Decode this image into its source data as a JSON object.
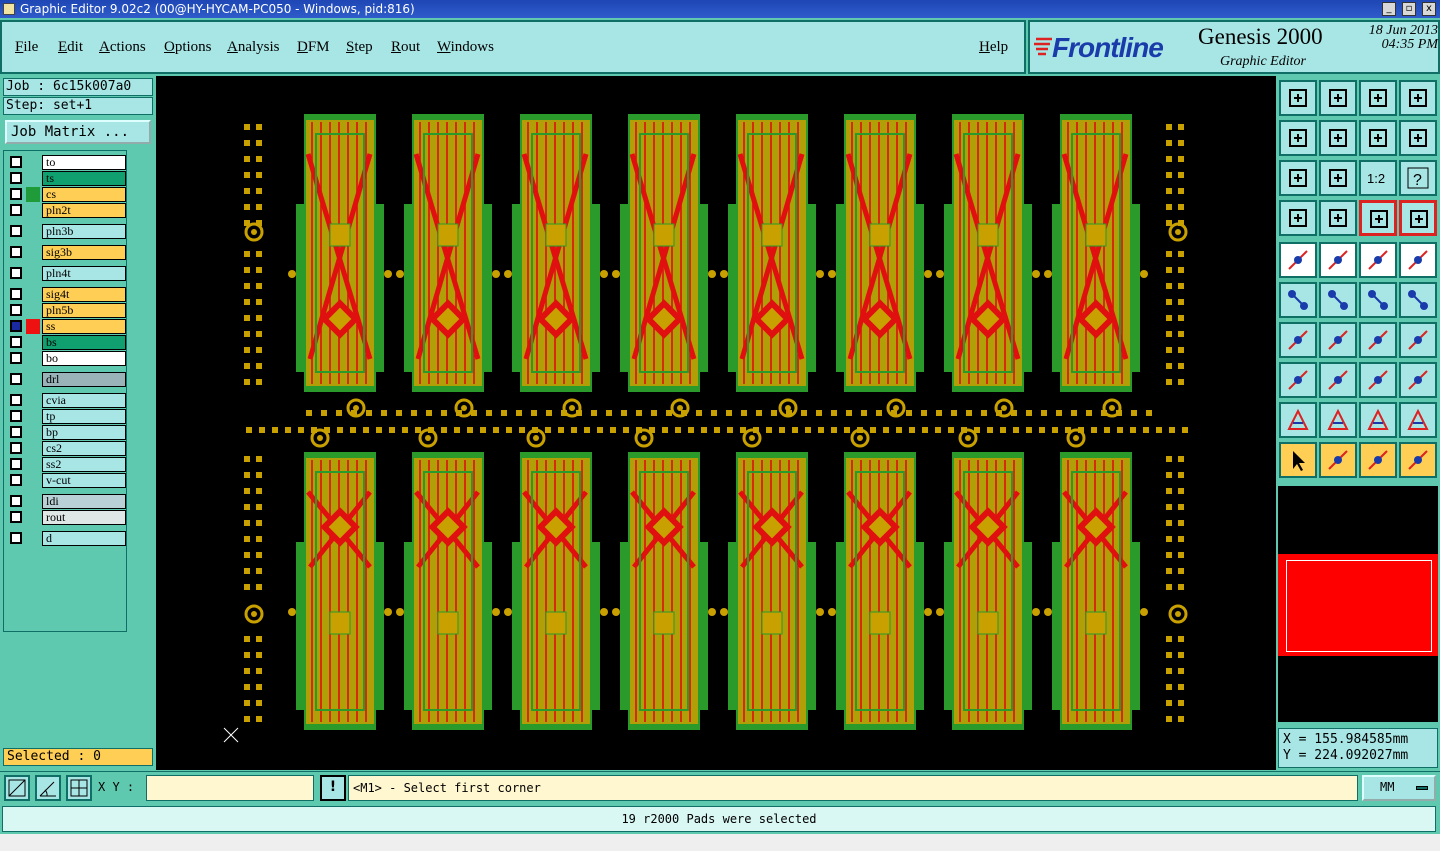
{
  "window": {
    "title": "Graphic Editor 9.02c2 (00@HY-HYCAM-PC050 - Windows, pid:816)"
  },
  "menu": [
    "File",
    "Edit",
    "Actions",
    "Options",
    "Analysis",
    "DFM",
    "Step",
    "Rout",
    "Windows",
    "Help"
  ],
  "brand": {
    "logo": "Frontline",
    "product": "Genesis 2000",
    "subtitle": "Graphic Editor",
    "date": "18 Jun 2013",
    "time": "04:35 PM"
  },
  "job": {
    "job_line": "Job : 6c15k007a0",
    "step_line": "Step: set+1",
    "matrix_button": "Job Matrix ..."
  },
  "layers": [
    {
      "name": "to",
      "bg": "#ffffff",
      "color": ""
    },
    {
      "name": "ts",
      "bg": "#10a070",
      "color": ""
    },
    {
      "name": "cs",
      "bg": "#ffcf55",
      "color": "#1f9b3a"
    },
    {
      "name": "pln2t",
      "bg": "#ffcf55",
      "color": ""
    },
    {
      "name": "pln3b",
      "bg": "#a8e6e6",
      "color": ""
    },
    {
      "name": "sig3b",
      "bg": "#ffcf55",
      "color": ""
    },
    {
      "name": "pln4t",
      "bg": "#a8e6e6",
      "color": ""
    },
    {
      "name": "sig4t",
      "bg": "#ffcf55",
      "color": ""
    },
    {
      "name": "pln5b",
      "bg": "#ffcf55",
      "color": ""
    },
    {
      "name": "ss",
      "bg": "#ffcf55",
      "color": "#ee1111"
    },
    {
      "name": "bs",
      "bg": "#10a070",
      "color": ""
    },
    {
      "name": "bo",
      "bg": "#ffffff",
      "color": ""
    },
    {
      "name": "drl",
      "bg": "#99b3b8",
      "color": ""
    },
    {
      "name": "cvia",
      "bg": "#a8e6e6",
      "color": ""
    },
    {
      "name": "tp",
      "bg": "#a8e6e6",
      "color": ""
    },
    {
      "name": "bp",
      "bg": "#a8e6e6",
      "color": ""
    },
    {
      "name": "cs2",
      "bg": "#a8e6e6",
      "color": ""
    },
    {
      "name": "ss2",
      "bg": "#a8e6e6",
      "color": ""
    },
    {
      "name": "v-cut",
      "bg": "#a8e6e6",
      "color": ""
    },
    {
      "name": "ldi",
      "bg": "#b9d0d6",
      "color": ""
    },
    {
      "name": "rout",
      "bg": "#dfe6e6",
      "color": ""
    },
    {
      "name": "d",
      "bg": "#a8e6e6",
      "color": ""
    }
  ],
  "selected": "Selected : 0",
  "coords": {
    "x": "X = 155.984585mm",
    "y": "Y = 224.092027mm"
  },
  "xy_label": "X Y :",
  "xy_value": "",
  "prompt": "<M1> - Select first corner",
  "unit": "MM",
  "status": "19 r2000 Pads were selected",
  "colors": {
    "board_green": "#2a9a2a",
    "copper": "#c8a000",
    "trace_red": "#e01010",
    "panel": "#5fc9b0",
    "light": "#a8e6e6"
  }
}
